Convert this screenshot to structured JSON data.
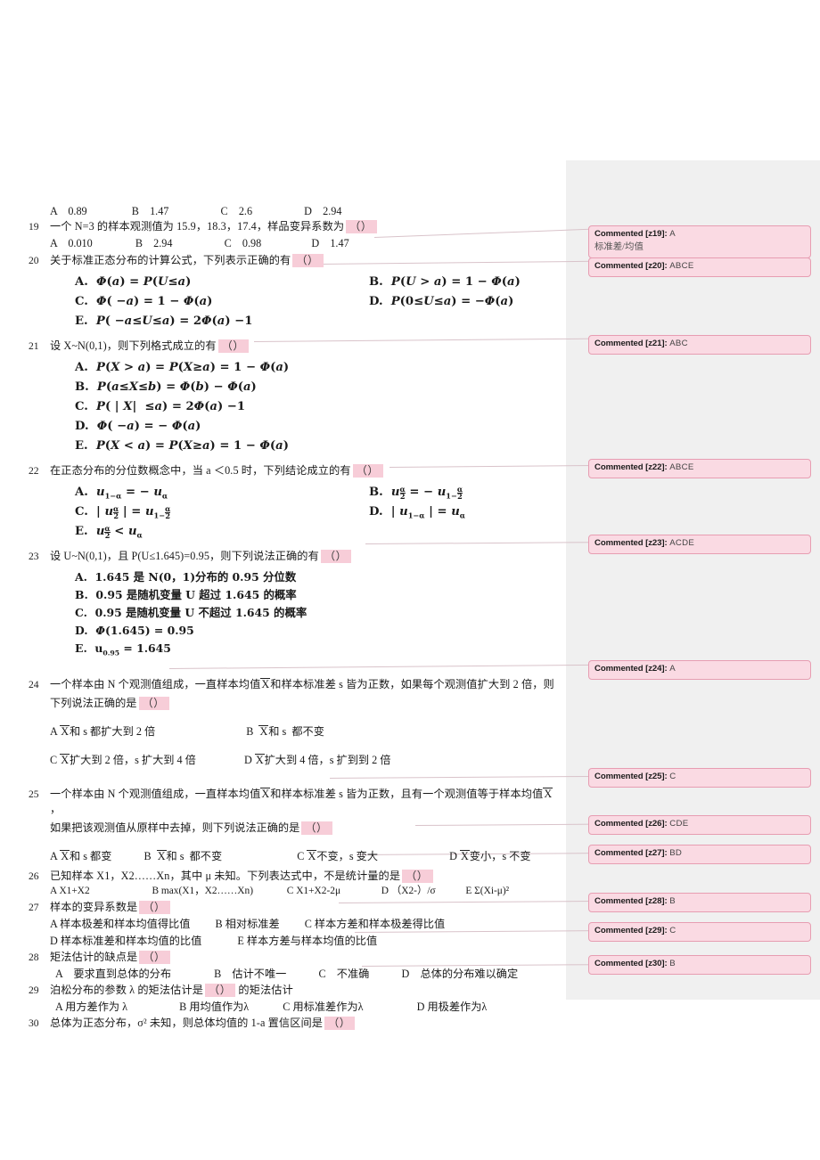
{
  "document": {
    "type": "exam-question-sheet",
    "margin_pane_color": "#f0f0f0",
    "highlight_color": "#f7cdd8",
    "comment_bg": "#fadae3",
    "comment_border": "#e79db2",
    "blank_marker": "（）"
  },
  "q18_options": {
    "a": "A　0.89",
    "b": "B　1.47",
    "c": "C　2.6",
    "d": "D　2.94"
  },
  "questions": [
    {
      "num": "19",
      "stem": "一个 N=3 的样本观测值为 15.9，18.3，17.4，样品变异系数为",
      "options_inline": [
        "A　0.010",
        "B　2.94",
        "C　0.98",
        "D　1.47"
      ]
    },
    {
      "num": "20",
      "stem": "关于标准正态分布的计算公式，下列表示正确的有"
    },
    {
      "num": "21",
      "stem": "设 X~N(0,1)，则下列格式成立的有"
    },
    {
      "num": "22",
      "stem": "在正态分布的分位数概念中，当 a ＜0.5 时，下列结论成立的有"
    },
    {
      "num": "23",
      "stem": "设 U~N(0,1)，且 P(U≤1.645)=0.95，则下列说法正确的有"
    },
    {
      "num": "24",
      "stem_line1": "一个样本由 N 个观测值组成，一直样本均值X和样本标准差 s 皆为正数，如果每个观测值扩大到 2 倍，则",
      "stem_line2": "下列说法正确的是",
      "options": [
        "A X和 s 都扩大到 2 倍",
        "B　X和 s 都不变",
        "C X扩大到 2 倍，s 扩大到 4 倍",
        "D X扩大到 4 倍，s 扩到到 2 倍"
      ]
    },
    {
      "num": "25",
      "stem_line1": "一个样本由 N 个观测值组成，一直样本均值X和样本标准差 s 皆为正数，且有一个观测值等于样本均值X，",
      "stem_line2": "如果把该观测值从原样中去掉，则下列说法正确的是",
      "options": [
        "A X和 s 都变",
        "B　X和 s 都不变",
        "C X不变，s 变大",
        "D X变小，s 不变"
      ]
    },
    {
      "num": "26",
      "stem": "已知样本 X1，X2……Xn，其中 μ 未知。下列表达式中，不是统计量的是",
      "options": [
        "A X1+X2",
        "B max(X1，X2……Xn)",
        "C X1+X2-2μ",
        "D （X2-）/σ",
        "E Σ(Xi-μ)²"
      ]
    },
    {
      "num": "27",
      "stem": "样本的变异系数是",
      "options_r1": [
        "A 样本极差和样本均值得比值",
        "B 相对标准差",
        "C 样本方差和样本极差得比值"
      ],
      "options_r2": [
        "D 样本标准差和样本均值的比值",
        "E 样本方差与样本均值的比值"
      ]
    },
    {
      "num": "28",
      "stem": "矩法估计的缺点是",
      "options": [
        "A　要求直到总体的分布",
        "B　估计不唯一",
        "C　不准确",
        "D　总体的分布难以确定"
      ]
    },
    {
      "num": "29",
      "stem_a": "泊松分布的参数 λ 的矩法估计是",
      "stem_b": "的矩法估计",
      "options": [
        "A 用方差作为 λ",
        "B 用均值作为λ",
        "C 用标准差作为λ",
        "D 用极差作为λ"
      ]
    },
    {
      "num": "30",
      "stem": "总体为正态分布，σ² 未知，则总体均值的 1-a 置信区间是"
    }
  ],
  "formulas": {
    "q20": [
      {
        "label": "A.",
        "col": "left",
        "tex": "Φ(a) = P(U≤a)"
      },
      {
        "label": "B.",
        "col": "right",
        "tex": "P(U>a) = 1 − Φ(a)"
      },
      {
        "label": "C.",
        "col": "left",
        "tex": "Φ(−a) = 1 − Φ(a)"
      },
      {
        "label": "D.",
        "col": "right",
        "tex": "P(0≤U≤a) = −Φ(a)"
      },
      {
        "label": "E.",
        "col": "left",
        "tex": "P(−a≤U≤a) = 2Φ(a) −1"
      }
    ],
    "q21": [
      {
        "label": "A.",
        "tex": "P(X>a) = P(X≥a) = 1 − Φ(a)"
      },
      {
        "label": "B.",
        "tex": "P(a≤X≤b) = Φ(b) − Φ(a)"
      },
      {
        "label": "C.",
        "tex": "P(|X| ≤a) = 2Φ(a) −1"
      },
      {
        "label": "D.",
        "tex": "Φ(−a) = −Φ(a)"
      },
      {
        "label": "E.",
        "tex": "P(X<a) = P(X≥a) = 1 − Φ(a)"
      }
    ],
    "q23": [
      {
        "label": "A.",
        "tex": "1.645 是 N(0，1)分布的 0.95 分位数"
      },
      {
        "label": "B.",
        "tex": "0.95 是随机变量 U 超过 1.645 的概率"
      },
      {
        "label": "C.",
        "tex": "0.95 是随机变量 U 不超过 1.645 的概率"
      },
      {
        "label": "D.",
        "tex": "Φ(1.645) = 0.95"
      },
      {
        "label": "E.",
        "tex": "u0.95 = 1.645"
      }
    ]
  },
  "comments": [
    {
      "id": "z19",
      "tag": "Commented [z19]:",
      "value": "A",
      "extra": "标准差/均值"
    },
    {
      "id": "z20",
      "tag": "Commented [z20]:",
      "value": "ABCE",
      "extra": ""
    },
    {
      "id": "z21",
      "tag": "Commented [z21]:",
      "value": "ABC",
      "extra": ""
    },
    {
      "id": "z22",
      "tag": "Commented [z22]:",
      "value": "ABCE",
      "extra": ""
    },
    {
      "id": "z23",
      "tag": "Commented [z23]:",
      "value": "ACDE",
      "extra": ""
    },
    {
      "id": "z24",
      "tag": "Commented [z24]:",
      "value": "A",
      "extra": ""
    },
    {
      "id": "z25",
      "tag": "Commented [z25]:",
      "value": "C",
      "extra": ""
    },
    {
      "id": "z26",
      "tag": "Commented [z26]:",
      "value": "CDE",
      "extra": ""
    },
    {
      "id": "z27",
      "tag": "Commented [z27]:",
      "value": "BD",
      "extra": ""
    },
    {
      "id": "z28",
      "tag": "Commented [z28]:",
      "value": "B",
      "extra": ""
    },
    {
      "id": "z29",
      "tag": "Commented [z29]:",
      "value": "C",
      "extra": ""
    },
    {
      "id": "z30",
      "tag": "Commented [z30]:",
      "value": "B",
      "extra": ""
    }
  ]
}
